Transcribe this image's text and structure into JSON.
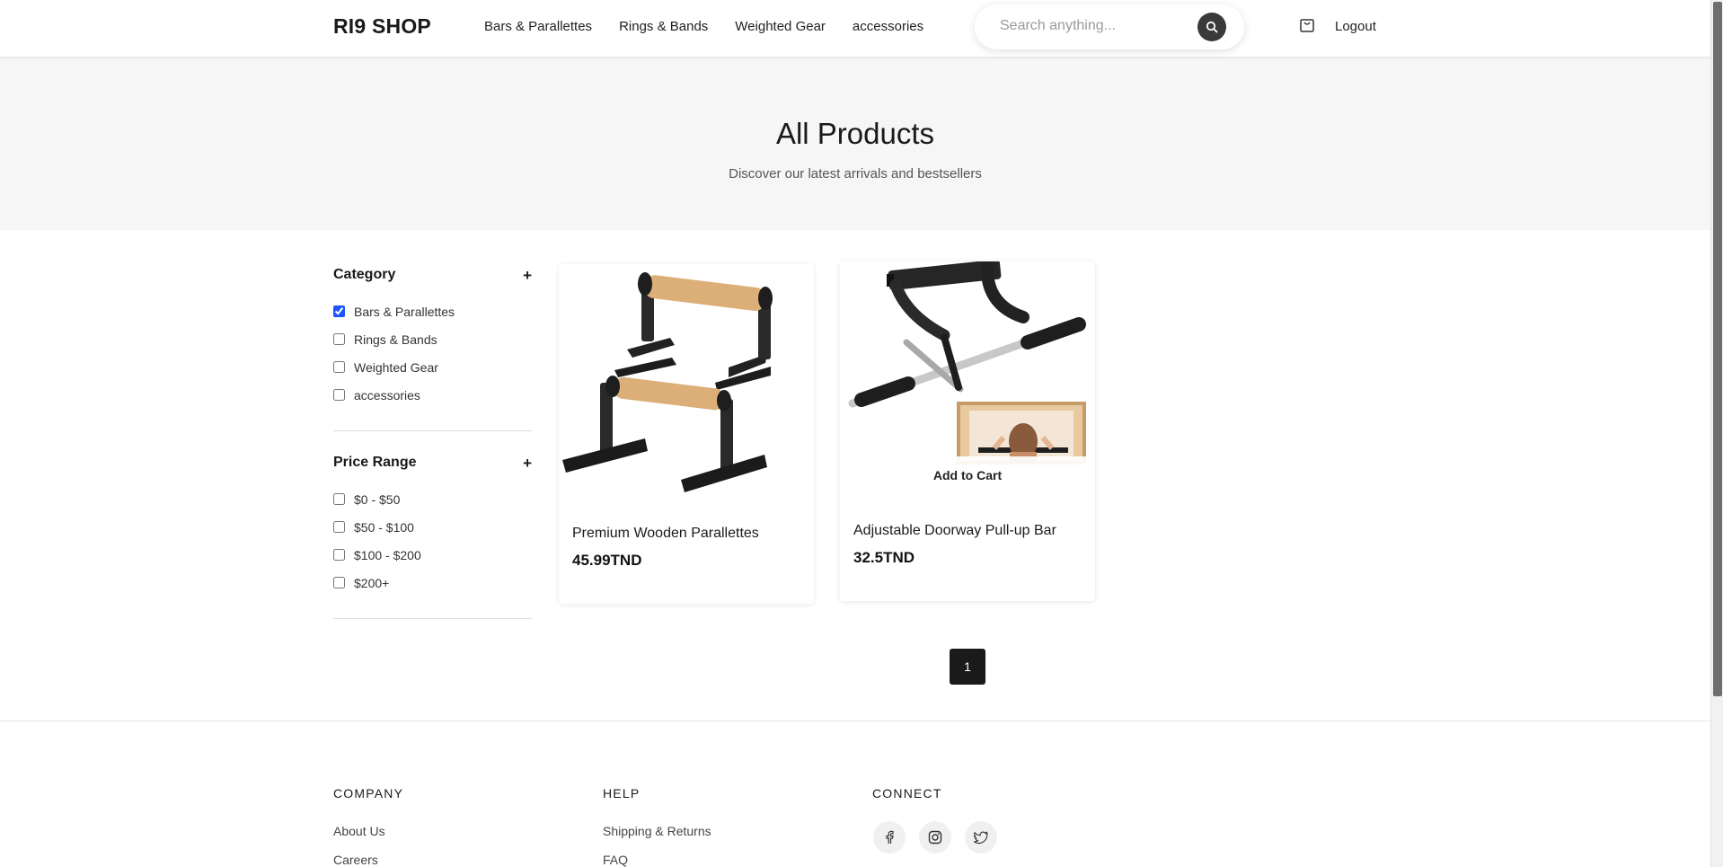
{
  "header": {
    "logo": "RI9 SHOP",
    "nav": [
      "Bars & Parallettes",
      "Rings & Bands",
      "Weighted Gear",
      "accessories"
    ],
    "search_placeholder": "Search anything...",
    "logout": "Logout"
  },
  "hero": {
    "title": "All Products",
    "subtitle": "Discover our latest arrivals and bestsellers"
  },
  "filters": {
    "category": {
      "title": "Category",
      "toggle": "+",
      "options": [
        {
          "label": "Bars & Parallettes",
          "checked": true
        },
        {
          "label": "Rings & Bands",
          "checked": false
        },
        {
          "label": "Weighted Gear",
          "checked": false
        },
        {
          "label": "accessories",
          "checked": false
        }
      ]
    },
    "price": {
      "title": "Price Range",
      "toggle": "+",
      "options": [
        {
          "label": "$0 - $50",
          "checked": false
        },
        {
          "label": "$50 - $100",
          "checked": false
        },
        {
          "label": "$100 - $200",
          "checked": false
        },
        {
          "label": "$200+",
          "checked": false
        }
      ]
    }
  },
  "products": [
    {
      "name": "Premium Wooden Parallettes",
      "price": "45.99TND"
    },
    {
      "name": "Adjustable Doorway Pull-up Bar",
      "price": "32.5TND",
      "add_to_cart": "Add to Cart"
    }
  ],
  "pagination": {
    "current": "1"
  },
  "footer": {
    "company": {
      "title": "COMPANY",
      "links": [
        "About Us",
        "Careers"
      ]
    },
    "help": {
      "title": "HELP",
      "links": [
        "Shipping & Returns",
        "FAQ"
      ]
    },
    "connect": {
      "title": "CONNECT",
      "icons": [
        "facebook-icon",
        "instagram-icon",
        "twitter-icon"
      ]
    }
  },
  "colors": {
    "accent": "#1a1a1a",
    "checkbox": "#1a55ff",
    "hero_bg": "#f6f6f6"
  }
}
